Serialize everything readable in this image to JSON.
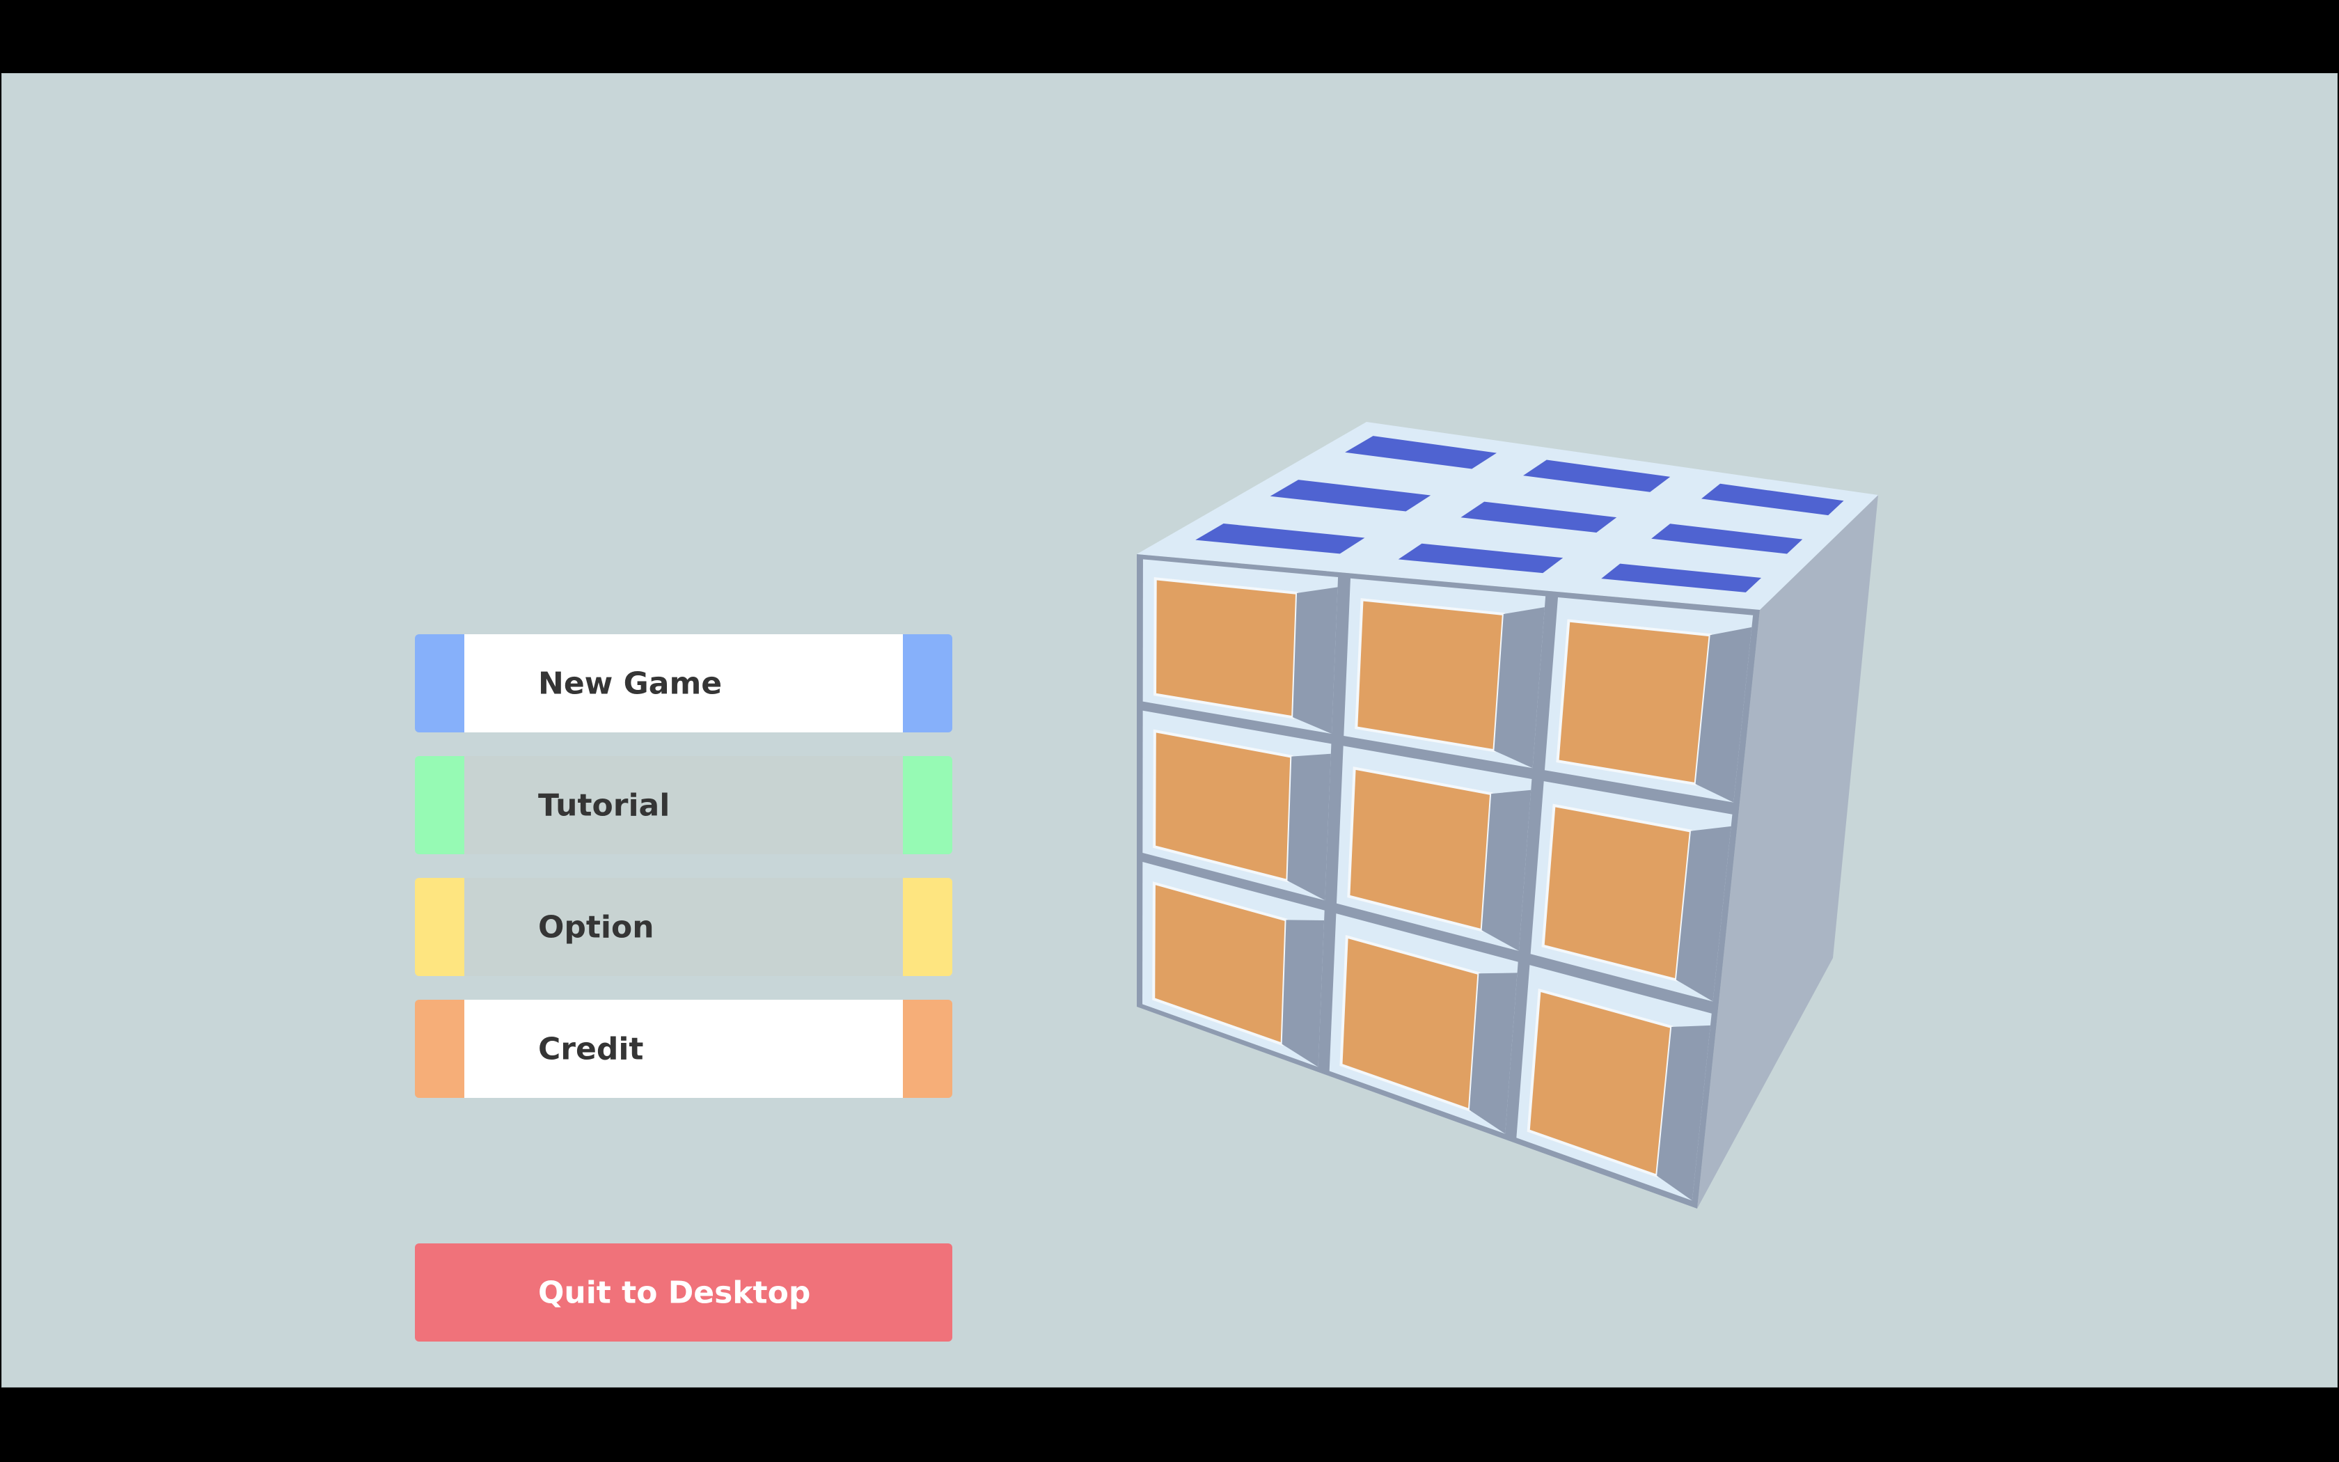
{
  "menu": {
    "items": [
      {
        "label": "New Game",
        "cap_color": "#86b0fa",
        "body_color": "#ffffff"
      },
      {
        "label": "Tutorial",
        "cap_color": "#96fab4",
        "body_color": "#c8d3d2"
      },
      {
        "label": "Option",
        "cap_color": "#fee580",
        "body_color": "#c8d3d2"
      },
      {
        "label": "Credit",
        "cap_color": "#f6ae78",
        "body_color": "#ffffff"
      }
    ],
    "quit": {
      "label": "Quit to Desktop",
      "color": "#f0727a"
    }
  },
  "scene": {
    "background": "#c8d6d8",
    "cube": {
      "top_color": "#4f63d1",
      "front_color": "#e0a062",
      "frame_color": "#dcebf7",
      "bevel_color": "#8e9bb0"
    }
  }
}
